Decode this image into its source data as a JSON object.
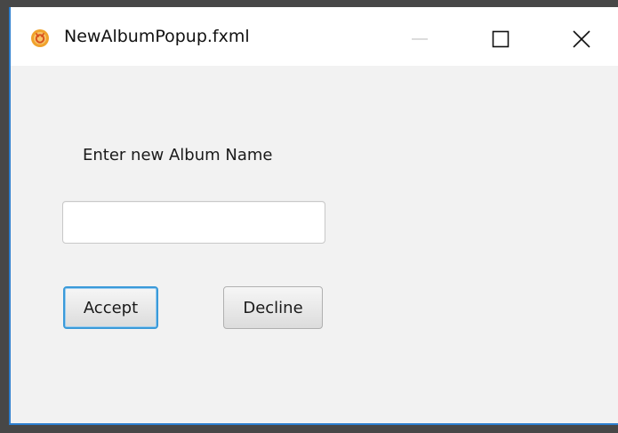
{
  "window": {
    "title": "NewAlbumPopup.fxml"
  },
  "form": {
    "label": "Enter new Album Name",
    "album_name_value": "",
    "album_name_placeholder": ""
  },
  "buttons": {
    "accept_label": "Accept",
    "decline_label": "Decline"
  },
  "icons": {
    "app": "app-icon",
    "minimize": "minimize-icon",
    "maximize": "maximize-icon",
    "close": "close-icon"
  },
  "colors": {
    "accent": "#2d7fd0",
    "background": "#f2f2f2",
    "titlebar": "#ffffff",
    "app_icon": "#f0a22c"
  }
}
